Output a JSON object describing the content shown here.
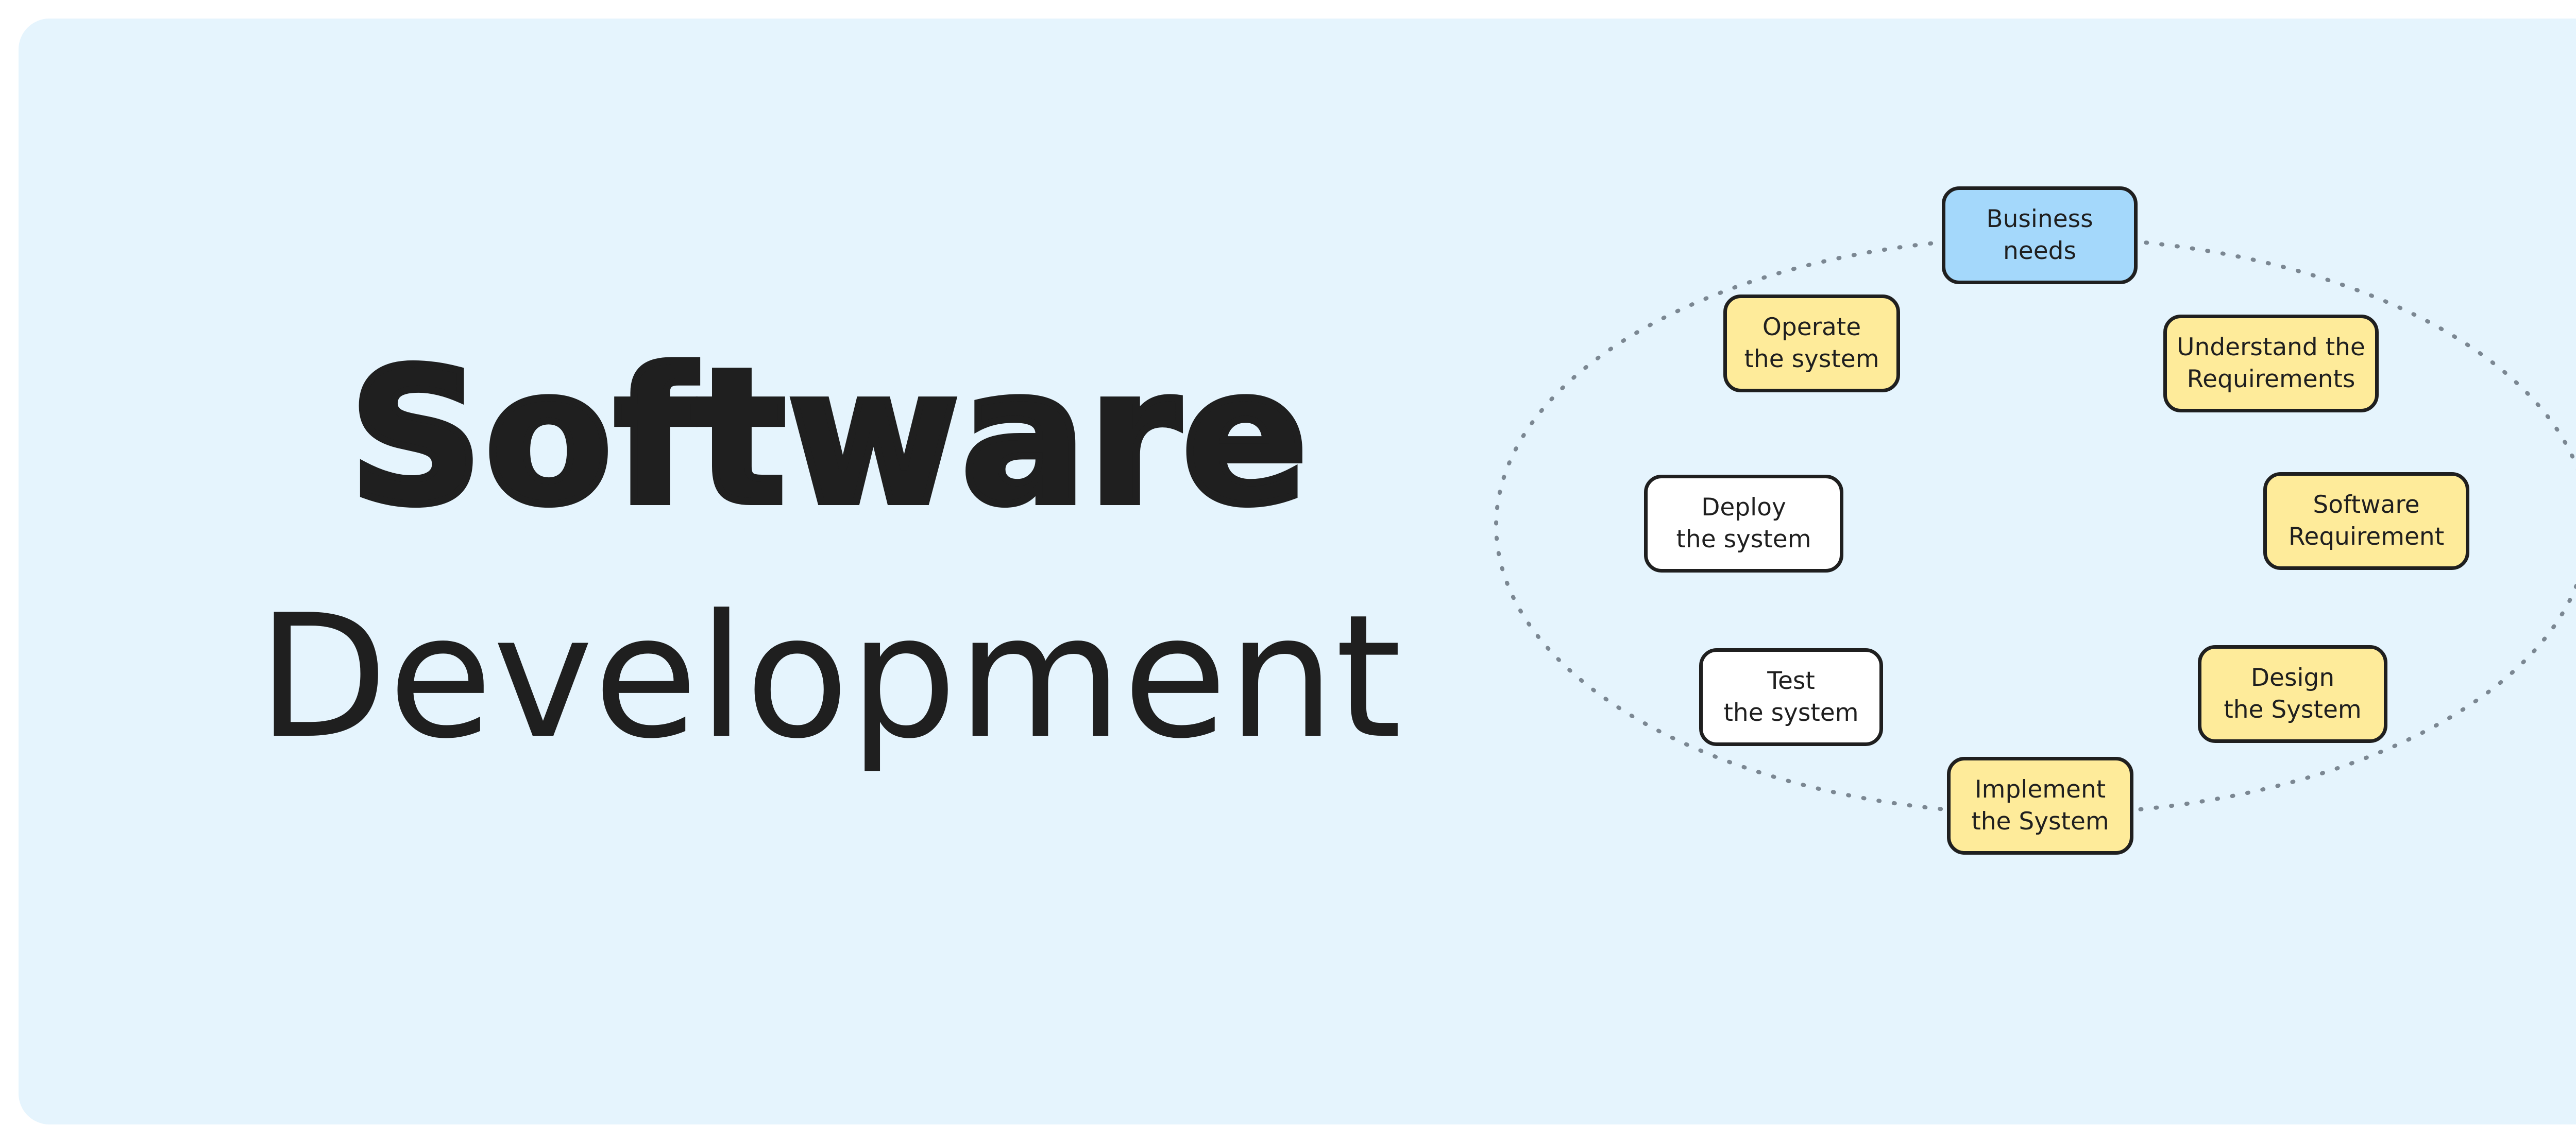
{
  "title": {
    "line1": "Software",
    "line2": "Development"
  },
  "colors": {
    "background": "#e5f4fd",
    "start_node": "#a4d8fb",
    "highlight_node": "#feeb9a",
    "plain_node": "#ffffff",
    "text": "#1f1f1f",
    "connector": "#7b8792"
  },
  "cycle": {
    "nodes": [
      {
        "id": "business-needs",
        "label": "Business\nneeds",
        "style": "blue"
      },
      {
        "id": "understand-requirements",
        "label": "Understand the\nRequirements",
        "style": "yellow"
      },
      {
        "id": "software-requirement",
        "label": "Software\nRequirement",
        "style": "yellow"
      },
      {
        "id": "design-system",
        "label": "Design\nthe System",
        "style": "yellow"
      },
      {
        "id": "implement-system",
        "label": "Implement\nthe System",
        "style": "yellow"
      },
      {
        "id": "test-system",
        "label": "Test\nthe system",
        "style": "white"
      },
      {
        "id": "deploy-system",
        "label": "Deploy\nthe system",
        "style": "white"
      },
      {
        "id": "operate-system",
        "label": "Operate\nthe system",
        "style": "yellow"
      }
    ]
  }
}
